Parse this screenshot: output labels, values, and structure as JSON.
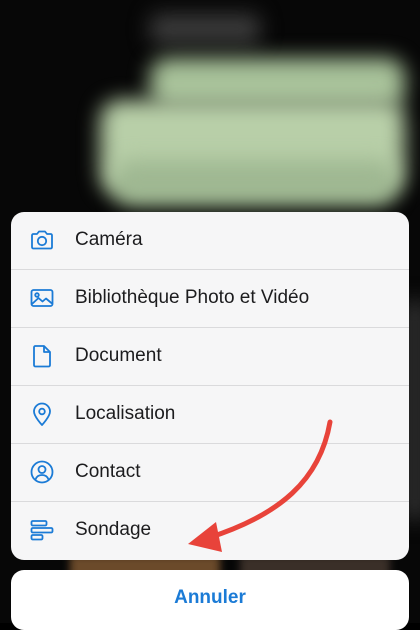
{
  "sheet": {
    "options": [
      {
        "label": "Caméra",
        "icon": "camera-icon"
      },
      {
        "label": "Bibliothèque Photo et Vidéo",
        "icon": "photo-library-icon"
      },
      {
        "label": "Document",
        "icon": "document-icon"
      },
      {
        "label": "Localisation",
        "icon": "location-pin-icon"
      },
      {
        "label": "Contact",
        "icon": "contact-icon"
      },
      {
        "label": "Sondage",
        "icon": "poll-icon"
      }
    ]
  },
  "cancel": {
    "label": "Annuler"
  },
  "colors": {
    "accent": "#1b7bd6",
    "annotation_arrow": "#e8433a",
    "sheet_bg": "#f6f6f7"
  }
}
